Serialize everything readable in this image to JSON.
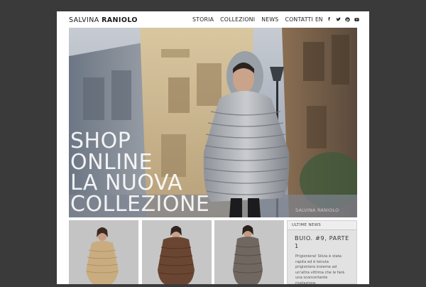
{
  "header": {
    "logo_first": "SALVINA",
    "logo_second": "RANIOLO",
    "nav": [
      {
        "label": "STORIA"
      },
      {
        "label": "COLLEZIONI"
      },
      {
        "label": "NEWS"
      },
      {
        "label": "CONTATTI"
      }
    ],
    "language": "EN",
    "social_icons": [
      "facebook-icon",
      "twitter-icon",
      "pinterest-icon",
      "youtube-icon"
    ]
  },
  "hero": {
    "lines": [
      "SHOP",
      "ONLINE",
      "LA NUOVA",
      "COLLEZIONE"
    ],
    "watermark": "SALVINA RANIOLO"
  },
  "thumbnails": [
    {
      "name": "thumb-beige-fur-coat"
    },
    {
      "name": "thumb-brown-fur-coat"
    },
    {
      "name": "thumb-grey-fur-coat"
    }
  ],
  "news": {
    "header": "ULTIME NEWS",
    "title": "BUIO. #9, PARTE 1",
    "body": "Prigioniera! Silvia è stata rapita ed è tenuta prigioniera insieme ad un'altra vittima che le farà una sconcertante rivelazione."
  },
  "colors": {
    "background": "#3a3a3a",
    "page": "#ffffff",
    "news_box": "#e2e2e2"
  }
}
